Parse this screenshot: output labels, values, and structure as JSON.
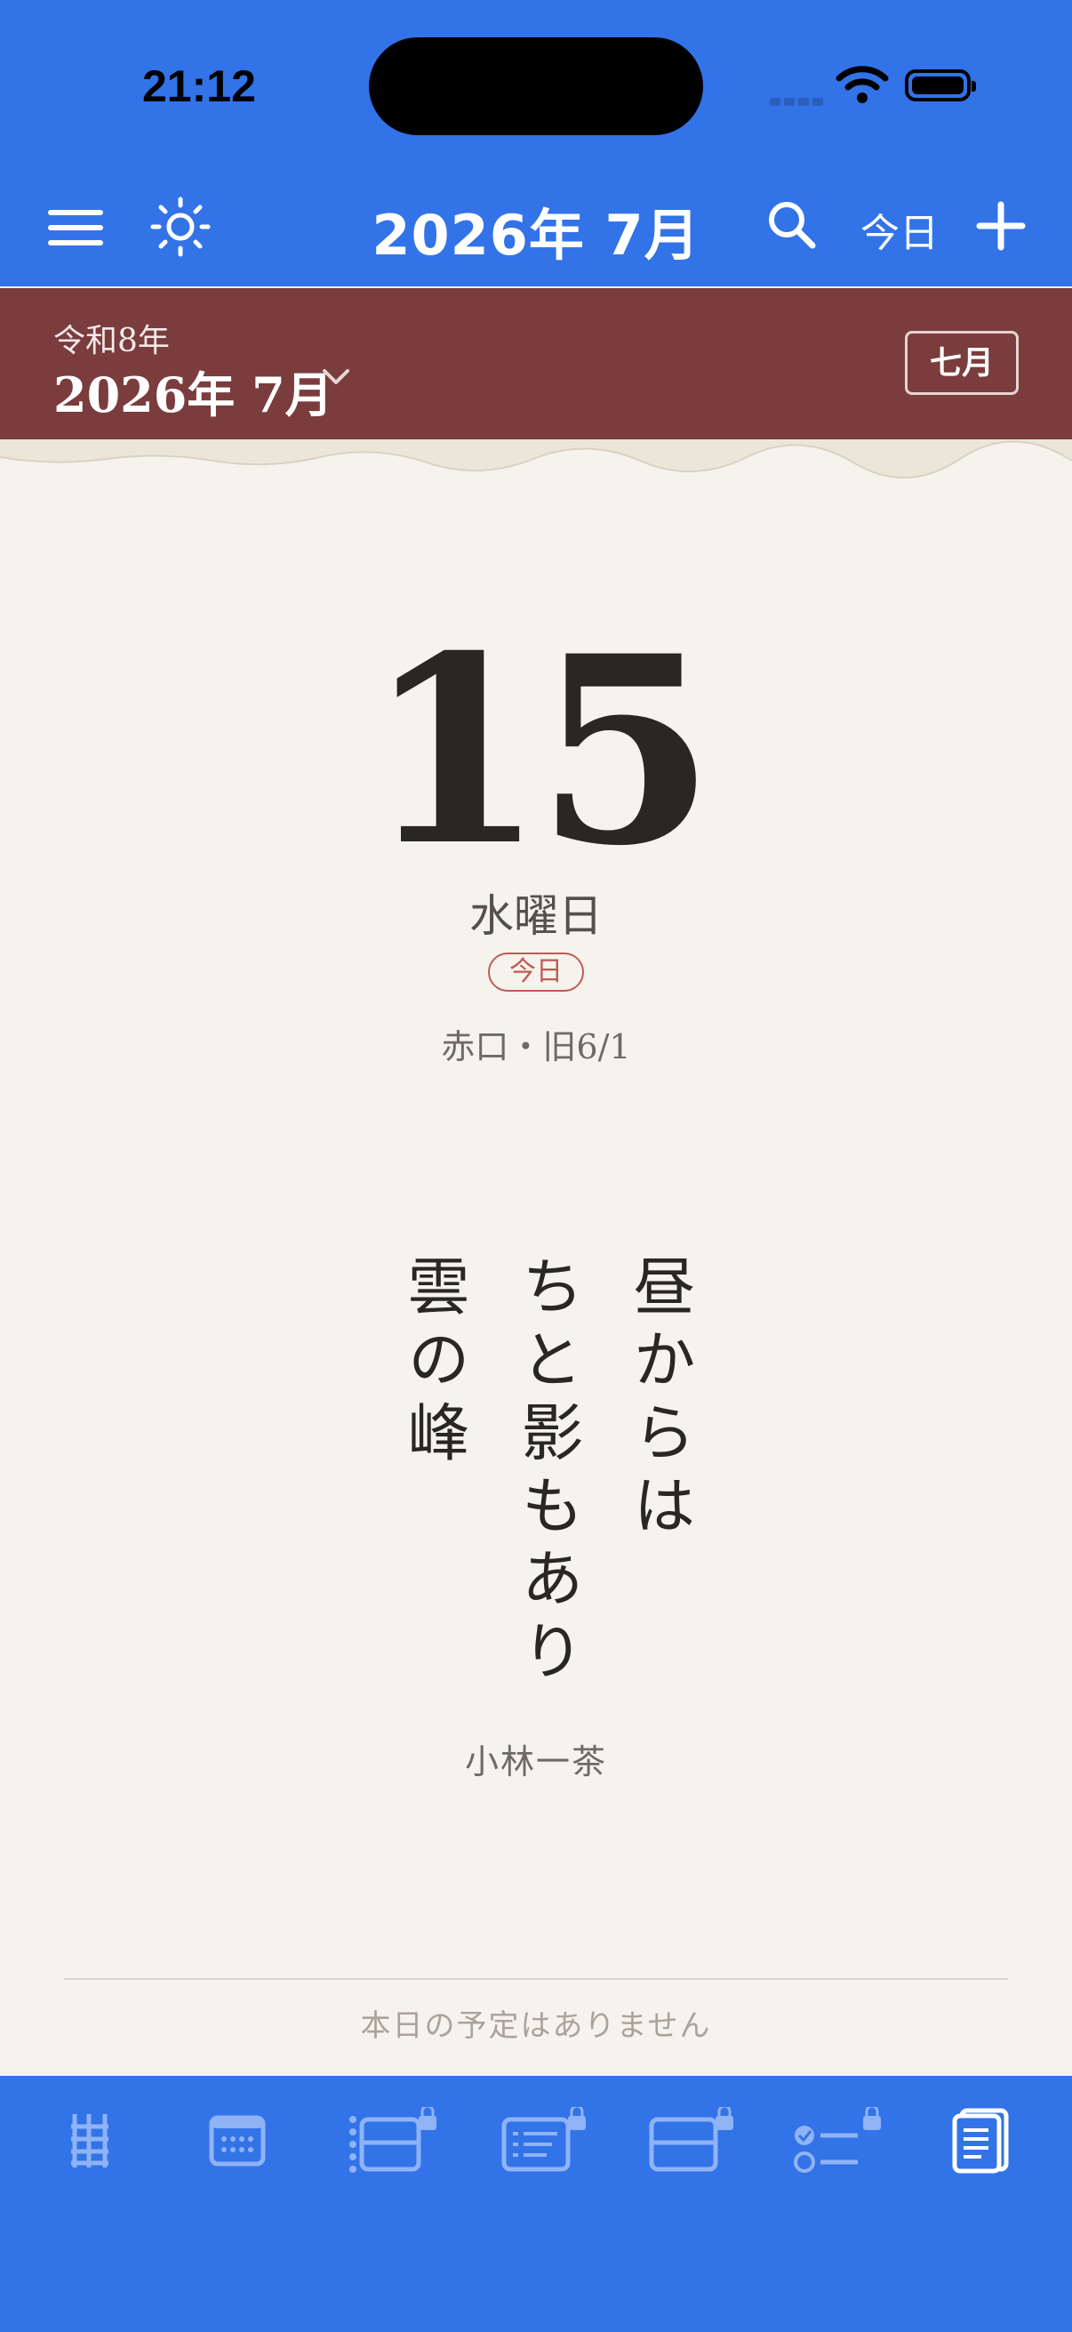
{
  "status_bar": {
    "time": "21:12"
  },
  "nav": {
    "title": "2026年 7月",
    "today_label": "今日",
    "icons": [
      "menu-icon",
      "sun-icon",
      "search-icon",
      "plus-icon"
    ]
  },
  "month_header": {
    "era": "令和8年",
    "month": "2026年 7月",
    "kanji_month": "七月"
  },
  "day": {
    "number": "15",
    "weekday": "水曜日",
    "today_badge": "今日",
    "rokuyo": "赤口・旧6/1"
  },
  "haiku": {
    "lines": [
      "昼からは",
      "ちと影もあり",
      "雲の峰"
    ],
    "author": "小林一茶"
  },
  "events": {
    "empty_message": "本日の予定はありません"
  },
  "tabbar": {
    "tabs": [
      "ladder-icon",
      "month-calendar-icon",
      "timeline-locked-icon",
      "list-locked-icon",
      "card-locked-icon",
      "todo-locked-icon",
      "daily-pages-icon"
    ],
    "active_tab": "daily-pages-icon"
  },
  "colors": {
    "accent_blue": "#3273e8",
    "header_red": "#7a3c3c",
    "paper": "#f6f3ec",
    "today_red": "#c05a56"
  }
}
